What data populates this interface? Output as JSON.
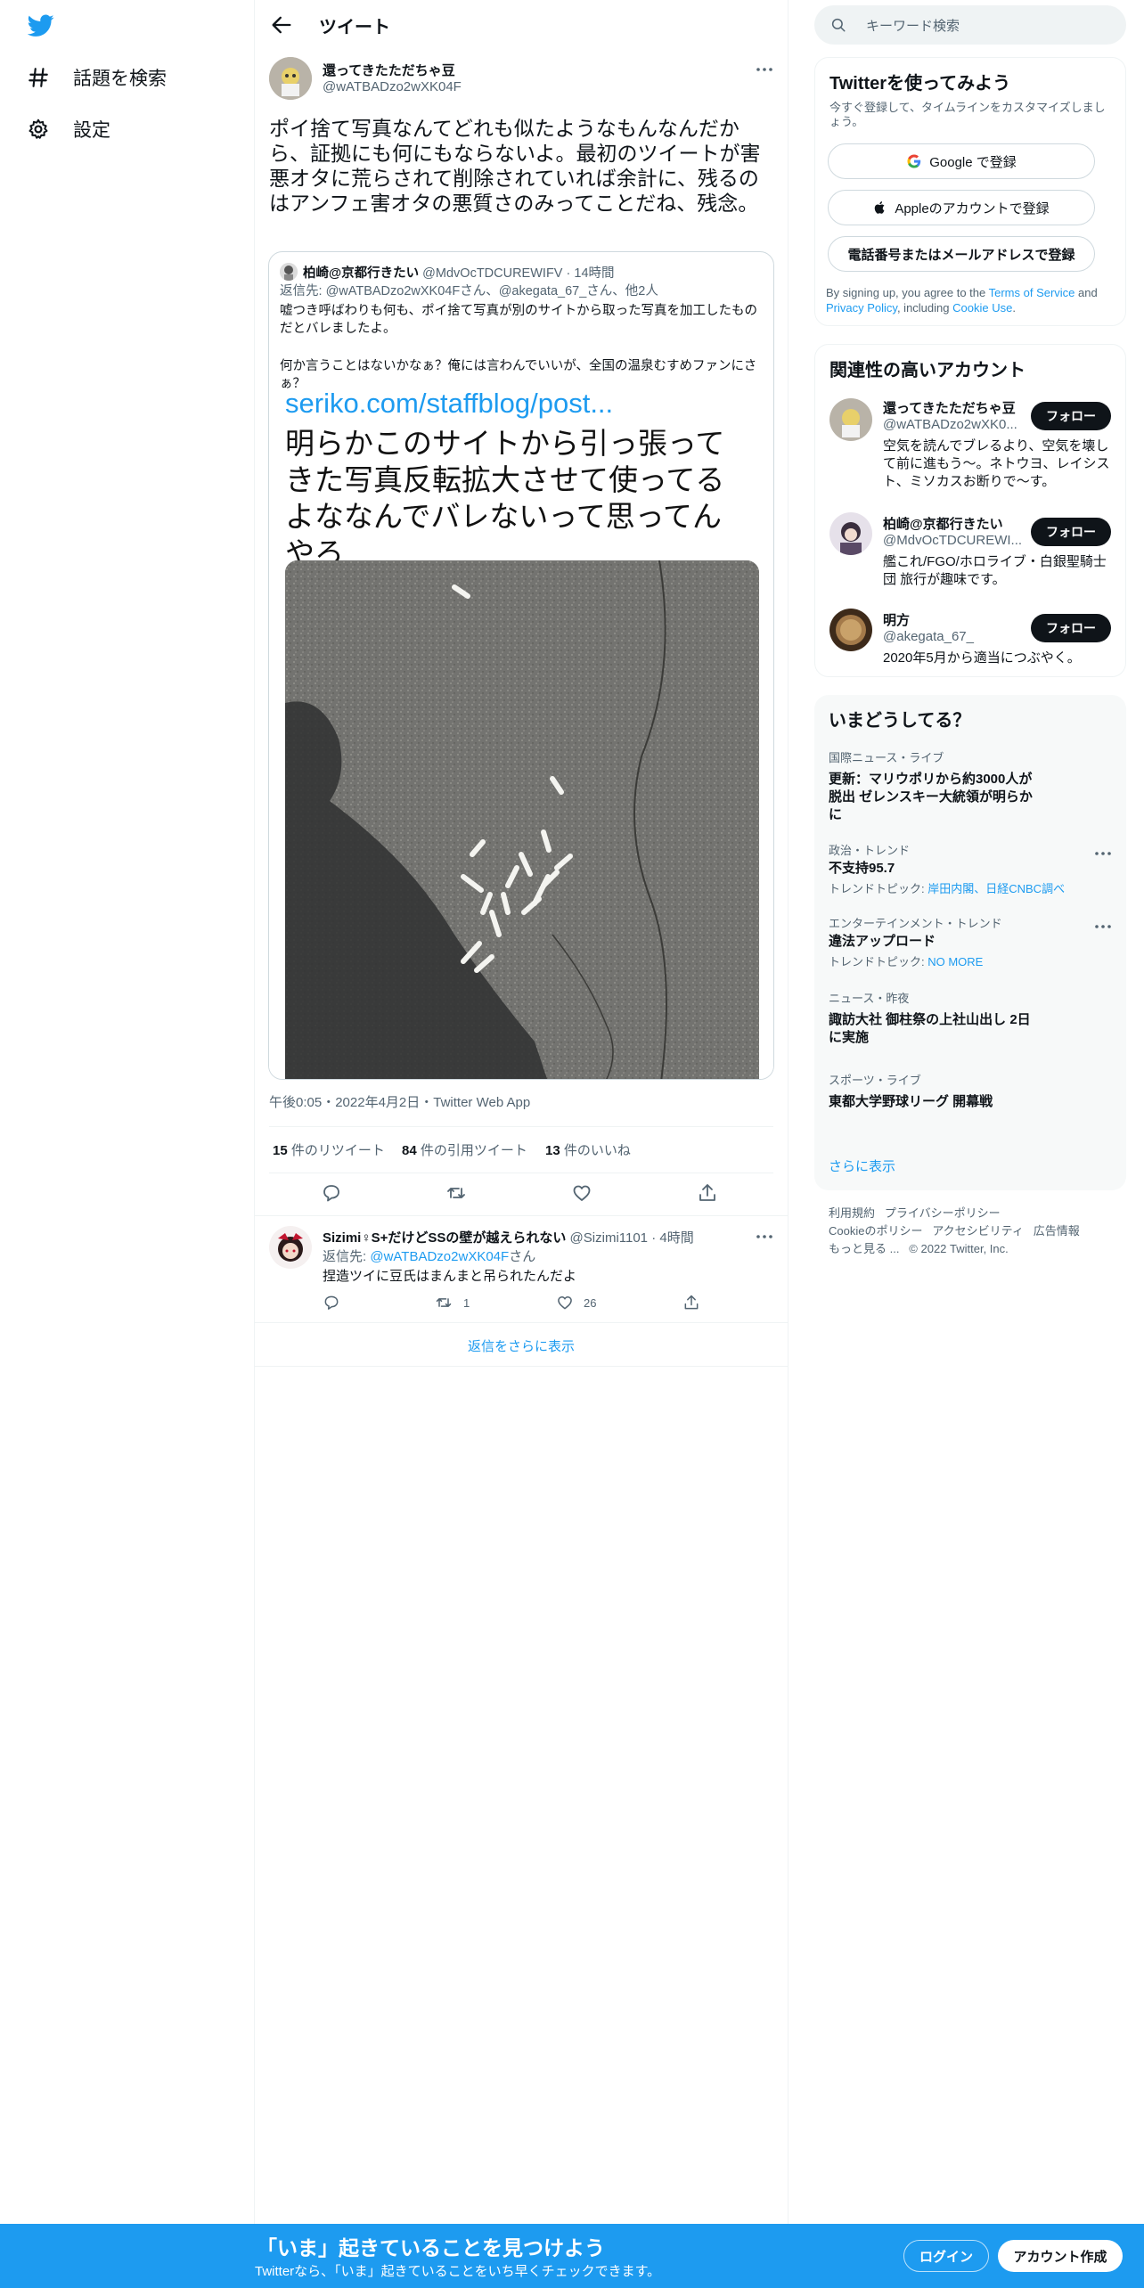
{
  "colors": {
    "accent": "#1d9bf0",
    "text": "#0f1419",
    "muted": "#536471",
    "border": "#eff3f4"
  },
  "nav": {
    "logo_icon": "twitter-bird-icon",
    "items": [
      {
        "label": "話題を検索",
        "icon": "hashtag-icon"
      },
      {
        "label": "設定",
        "icon": "gear-icon"
      }
    ]
  },
  "header": {
    "title": "ツイート",
    "back_icon": "arrow-left-icon"
  },
  "tweet": {
    "name": "還ってきたただちゃ豆",
    "handle": "@wATBADzo2wXK04F",
    "text": "ポイ捨て写真なんてどれも似たようなもんなんだから、証拠にも何にもならないよ。最初のツイートが害悪オタに荒らされて削除されていれば余計に、残るのはアンフェ害オタの悪質さのみってことだね、残念。",
    "quote": {
      "name": "柏崎@京都行きたい",
      "handle": "@MdvOcTDCUREWIFV",
      "time": "14時間",
      "reply_prefix": "返信先: ",
      "reply_to": "@wATBADzo2wXK04Fさん、@akegata_67_さん、他2人",
      "text1": "嘘つき呼ばわりも何も、ポイ捨て写真が別のサイトから取った写真を加工したものだとバレましたよ。",
      "text2": "何か言うことはないかなぁ？俺には言わんでいいが、全国の温泉むすめファンにさぁ？",
      "image_url_text": "seriko.com/staffblog/post...",
      "image_caption": "明らかこのサイトから引っ張ってきた写真反転拡大させて使ってるよななんでバレないって思ってんやろ"
    },
    "timestamp": "午後0:05・2022年4月2日・Twitter Web App",
    "stats": [
      {
        "num": "15",
        "label": " 件のリツイート"
      },
      {
        "num": "84",
        "label": " 件の引用ツイート"
      },
      {
        "num": "13",
        "label": " 件のいいね"
      }
    ]
  },
  "reply": {
    "name": "Sizimi♀S+だけどSSの壁が越えられない",
    "handle": "@Sizimi1101",
    "time": "4時間",
    "reply_prefix": "返信先: ",
    "reply_to": "@wATBADzo2wXK04F",
    "reply_suffix": "さん",
    "text": "捏造ツイに豆氏はまんまと吊られたんだよ",
    "retweets": "1",
    "likes": "26"
  },
  "show_more_replies": "返信をさらに表示",
  "search": {
    "placeholder": "キーワード検索"
  },
  "signup": {
    "title": "Twitterを使ってみよう",
    "subtitle": "今すぐ登録して、タイムラインをカスタマイズしましょう。",
    "google": "Google で登録",
    "apple": "Appleのアカウントで登録",
    "phone": "電話番号またはメールアドレスで登録",
    "terms_pre": "By signing up, you agree to the ",
    "terms_link": "Terms of Service",
    "terms_and": " and ",
    "privacy_link": "Privacy Policy",
    "terms_mid": ", including ",
    "cookie_link": "Cookie Use",
    "terms_end": "."
  },
  "related": {
    "title": "関連性の高いアカウント",
    "follow_label": "フォロー",
    "accounts": [
      {
        "name": "還ってきたただちゃ豆",
        "handle": "@wATBADzo2wXK0...",
        "bio": "空気を読んでブレるより、空気を壊して前に進もう～。ネトウヨ、レイシスト、ミソカスお断りで～す。"
      },
      {
        "name": "柏崎@京都行きたい",
        "handle": "@MdvOcTDCUREWI...",
        "bio": "艦これ/FGO/ホロライブ・白銀聖騎士団 旅行が趣味です。"
      },
      {
        "name": "明方",
        "handle": "@akegata_67_",
        "bio": "2020年5月から適当につぶやく。"
      }
    ]
  },
  "trends": {
    "title": "いまどうしてる？",
    "items": [
      {
        "category": "国際ニュース・ライブ",
        "title": "更新：マリウポリから約3000人が脱出 ゼレンスキー大統領が明らかに",
        "sub_prefix": "",
        "sub_link": ""
      },
      {
        "category": "政治・トレンド",
        "title": "不支持95.7",
        "sub_prefix": "トレンドトピック: ",
        "sub_link": "岸田内閣、日経CNBC調べ"
      },
      {
        "category": "エンターテインメント・トレンド",
        "title": "違法アップロード",
        "sub_prefix": "トレンドトピック: ",
        "sub_link": "NO MORE"
      },
      {
        "category": "ニュース・昨夜",
        "title": "諏訪大社 御柱祭の上社山出し 2日に実施",
        "sub_prefix": "",
        "sub_link": ""
      },
      {
        "category": "スポーツ・ライブ",
        "title": "東都大学野球リーグ 開幕戦",
        "sub_prefix": "",
        "sub_link": ""
      }
    ],
    "show_more": "さらに表示"
  },
  "footer": {
    "links": [
      "利用規約",
      "プライバシーポリシー",
      "Cookieのポリシー",
      "アクセシビリティ",
      "広告情報",
      "もっと見る ..."
    ],
    "copyright": "© 2022 Twitter, Inc."
  },
  "banner": {
    "title": "「いま」起きていることを見つけよう",
    "subtitle": "Twitterなら、「いま」起きていることをいち早くチェックできます。",
    "login": "ログイン",
    "signup": "アカウント作成"
  }
}
